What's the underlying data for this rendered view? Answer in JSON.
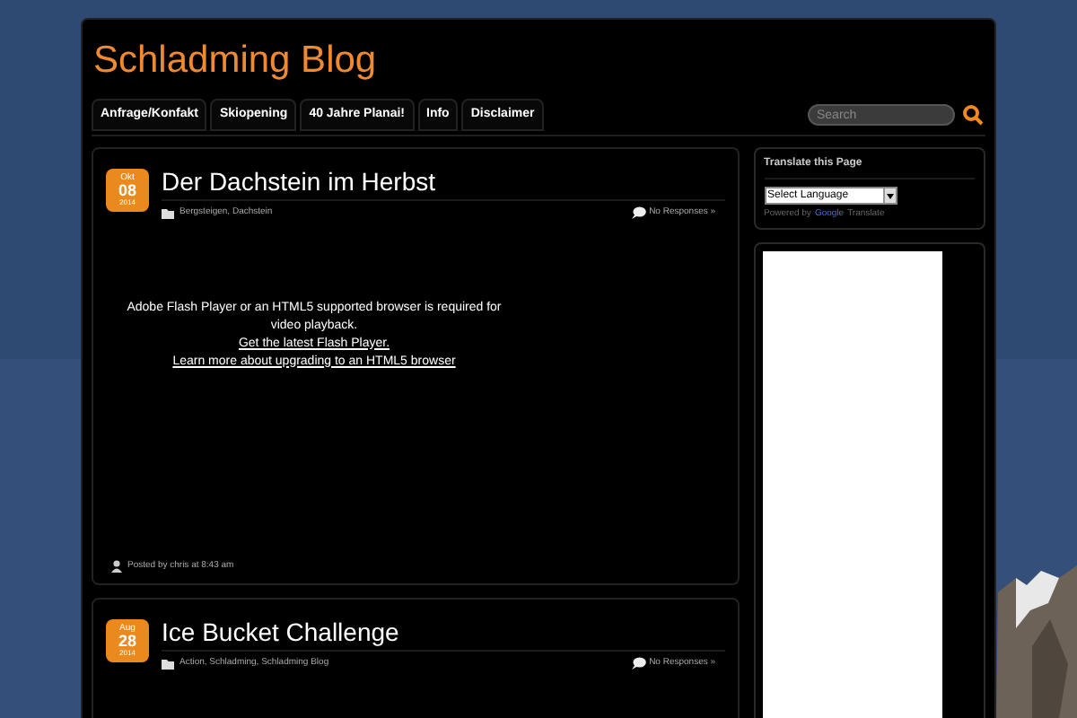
{
  "site_title": "Schladming Blog",
  "nav": [
    {
      "label": "Anfrage/Konfakt"
    },
    {
      "label": "Skiopening"
    },
    {
      "label": "40 Jahre Planai!"
    },
    {
      "label": "Info"
    },
    {
      "label": "Disclaimer"
    }
  ],
  "search": {
    "placeholder": "Search"
  },
  "posts": [
    {
      "month": "Okt",
      "day": "08",
      "year": "2014",
      "title": "Der Dachstein im Herbst",
      "categories": "Bergsteigen, Dachstein",
      "responses": "No Responses »",
      "flash_message": "Adobe Flash Player or an HTML5 supported browser is required for video playback.",
      "links": [
        "Get the latest Flash Player.",
        "Learn more about upgrading to an HTML5 browser"
      ],
      "byline": "Posted by chris at 8:43 am"
    },
    {
      "month": "Aug",
      "day": "28",
      "year": "2014",
      "title": "Ice Bucket Challenge",
      "categories": "Action, Schladming, Schladming Blog",
      "responses": "No Responses »"
    }
  ],
  "translate_widget": {
    "title": "Translate this Page",
    "select_value": "Select Language",
    "powered_by": "Powered by",
    "google": "Google",
    "translate": "Translate"
  }
}
